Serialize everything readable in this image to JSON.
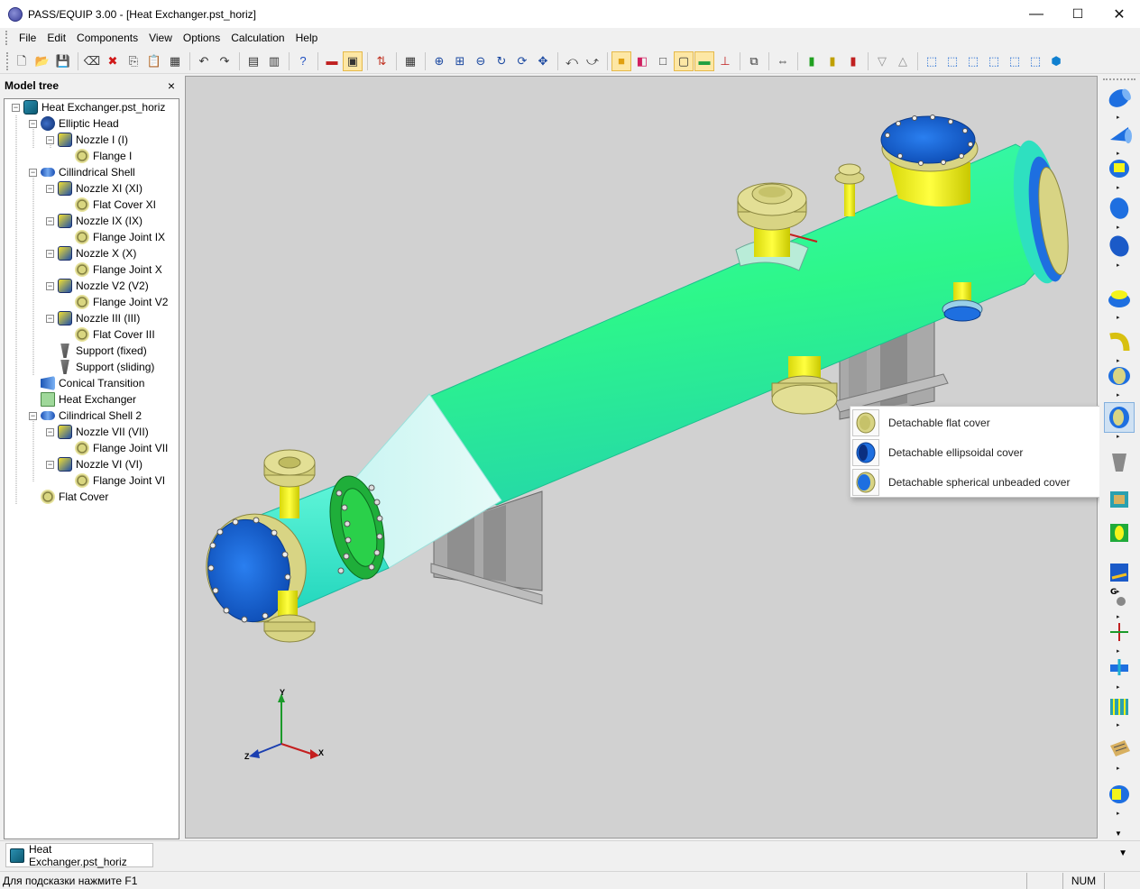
{
  "window": {
    "title": "PASS/EQUIP 3.00 - [Heat Exchanger.pst_horiz]",
    "minimize_glyph": "—",
    "maximize_glyph": "☐",
    "close_glyph": "✕"
  },
  "menu": [
    "File",
    "Edit",
    "Components",
    "View",
    "Options",
    "Calculation",
    "Help"
  ],
  "toolbar": {
    "buttons": [
      "new-file-icon",
      "open-folder-icon",
      "save-icon",
      "sep",
      "eraser-icon",
      "delete-icon",
      "copy-icon",
      "paste-icon",
      "properties-grid-icon",
      "sep",
      "undo-icon",
      "redo-icon",
      "sep",
      "table-icon",
      "report-icon",
      "sep",
      "help-icon",
      "sep",
      "russian-flag-icon",
      "language-icon",
      "sep",
      "units-icon",
      "sep",
      "grid-icon",
      "sep",
      "zoom-in-icon",
      "zoom-window-icon",
      "zoom-out-icon",
      "rotate-icon",
      "rotate-axis-icon",
      "pan-icon",
      "sep",
      "view-rotate-left-icon",
      "view-rotate-right-icon",
      "sep",
      "solid-view-icon",
      "color-view-icon",
      "wireframe-icon",
      "hidden-line-icon",
      "shade-icon",
      "axes-icon",
      "sep",
      "section-icon",
      "sep",
      "dimension-icon",
      "sep",
      "signal-green-icon",
      "signal-yellow-icon",
      "signal-red-icon",
      "sep",
      "view-front-icon",
      "view-back-icon",
      "sep",
      "iso-view-1-icon",
      "iso-view-2-icon",
      "iso-view-3-icon",
      "iso-view-4-icon",
      "iso-view-5-icon",
      "iso-view-6-icon",
      "iso-view-7-icon"
    ]
  },
  "model_tree": {
    "title": "Model tree",
    "close_glyph": "×",
    "items": [
      {
        "label": "Heat Exchanger.pst_horiz",
        "icon": "root",
        "level": 0,
        "expander": "−"
      },
      {
        "label": "Elliptic Head",
        "icon": "head",
        "level": 1,
        "expander": "−"
      },
      {
        "label": "Nozzle I (I)",
        "icon": "nozzle",
        "level": 2,
        "expander": "−"
      },
      {
        "label": "Flange I",
        "icon": "flange",
        "level": 3,
        "expander": ""
      },
      {
        "label": "Cillindrical Shell",
        "icon": "shell",
        "level": 1,
        "expander": "−"
      },
      {
        "label": "Nozzle XI (XI)",
        "icon": "nozzle",
        "level": 2,
        "expander": "−"
      },
      {
        "label": "Flat Cover XI",
        "icon": "flange",
        "level": 3,
        "expander": ""
      },
      {
        "label": "Nozzle IX (IX)",
        "icon": "nozzle",
        "level": 2,
        "expander": "−"
      },
      {
        "label": "Flange Joint IX",
        "icon": "flange",
        "level": 3,
        "expander": ""
      },
      {
        "label": "Nozzle X (X)",
        "icon": "nozzle",
        "level": 2,
        "expander": "−"
      },
      {
        "label": "Flange Joint X",
        "icon": "flange",
        "level": 3,
        "expander": ""
      },
      {
        "label": "Nozzle V2 (V2)",
        "icon": "nozzle",
        "level": 2,
        "expander": "−"
      },
      {
        "label": "Flange Joint V2",
        "icon": "flange",
        "level": 3,
        "expander": ""
      },
      {
        "label": "Nozzle III (III)",
        "icon": "nozzle",
        "level": 2,
        "expander": "−"
      },
      {
        "label": "Flat Cover III",
        "icon": "flange",
        "level": 3,
        "expander": ""
      },
      {
        "label": "Support (fixed)",
        "icon": "support",
        "level": 2,
        "expander": ""
      },
      {
        "label": "Support (sliding)",
        "icon": "support",
        "level": 2,
        "expander": ""
      },
      {
        "label": "Conical Transition",
        "icon": "cone",
        "level": 1,
        "expander": ""
      },
      {
        "label": "Heat Exchanger",
        "icon": "hx",
        "level": 1,
        "expander": ""
      },
      {
        "label": "Cilindrical Shell 2",
        "icon": "shell",
        "level": 1,
        "expander": "−"
      },
      {
        "label": "Nozzle VII (VII)",
        "icon": "nozzle",
        "level": 2,
        "expander": "−"
      },
      {
        "label": "Flange Joint VII",
        "icon": "flange",
        "level": 3,
        "expander": ""
      },
      {
        "label": "Nozzle VI (VI)",
        "icon": "nozzle",
        "level": 2,
        "expander": "−"
      },
      {
        "label": "Flange Joint VI",
        "icon": "flange",
        "level": 3,
        "expander": ""
      },
      {
        "label": "Flat Cover",
        "icon": "flange",
        "level": 1,
        "expander": ""
      }
    ]
  },
  "viewport": {
    "axes": {
      "y": "Y",
      "x": "X",
      "z": "Z"
    }
  },
  "component_flyout": {
    "items": [
      {
        "label": "Detachable flat cover",
        "icon": "flat-cover-icon"
      },
      {
        "label": "Detachable ellipsoidal cover",
        "icon": "ellipsoidal-cover-icon"
      },
      {
        "label": "Detachable spherical unbeaded cover",
        "icon": "spherical-cover-icon"
      }
    ]
  },
  "right_toolbox": {
    "buttons": [
      "cylindrical-shell-icon",
      "conical-shell-icon",
      "nozzle-icon",
      "elliptic-head-icon",
      "spherical-head-icon",
      "flange-icon",
      "bend-icon",
      "flange-joint-icon",
      "cover-icon",
      "support-icon",
      "saddle-icon",
      "lifting-lug-icon",
      "plate-icon",
      "load-g-icon",
      "force-moment-icon",
      "pipe-load-icon",
      "tube-bundle-icon",
      "heat-exchanger-icon",
      "jacket-icon"
    ]
  },
  "tabs": [
    {
      "label": "Heat Exchanger.pst_horiz"
    }
  ],
  "status": {
    "hint": "Для подсказки нажмите F1",
    "num": "NUM"
  },
  "colors": {
    "shell_green": "#2df78a",
    "shell_cyan": "#30e8d0",
    "cone": "#b9f2ef",
    "nozzle_yellow": "#f4f41a",
    "flange_tan": "#d8d484",
    "cover_blue": "#1e6fe0",
    "support_gray": "#9a9a9a",
    "viewport_bg": "#d1d1d1"
  }
}
